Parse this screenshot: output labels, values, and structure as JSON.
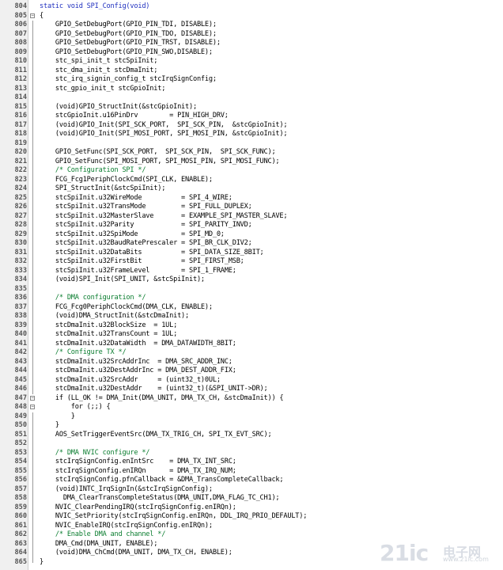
{
  "editor": {
    "lines": [
      {
        "n": "804",
        "t": "static void SPI_Config(void)",
        "k": "keyword"
      },
      {
        "n": "805",
        "t": "{",
        "fold": "minus"
      },
      {
        "n": "806",
        "t": "    GPIO_SetDebugPort(GPIO_PIN_TDI, DISABLE);"
      },
      {
        "n": "807",
        "t": "    GPIO_SetDebugPort(GPIO_PIN_TDO, DISABLE);"
      },
      {
        "n": "808",
        "t": "    GPIO_SetDebugPort(GPIO_PIN_TRST, DISABLE);"
      },
      {
        "n": "809",
        "t": "    GPIO_SetDebugPort(GPIO_PIN_SWO,DISABLE);"
      },
      {
        "n": "810",
        "t": "    stc_spi_init_t stcSpiInit;"
      },
      {
        "n": "811",
        "t": "    stc_dma_init_t stcDmaInit;"
      },
      {
        "n": "812",
        "t": "    stc_irq_signin_config_t stcIrqSignConfig;"
      },
      {
        "n": "813",
        "t": "    stc_gpio_init_t stcGpioInit;"
      },
      {
        "n": "814",
        "t": ""
      },
      {
        "n": "815",
        "t": "    (void)GPIO_StructInit(&stcGpioInit);"
      },
      {
        "n": "816",
        "t": "    stcGpioInit.u16PinDrv        = PIN_HIGH_DRV;"
      },
      {
        "n": "817",
        "t": "    (void)GPIO_Init(SPI_SCK_PORT,  SPI_SCK_PIN,  &stcGpioInit);"
      },
      {
        "n": "818",
        "t": "    (void)GPIO_Init(SPI_MOSI_PORT, SPI_MOSI_PIN, &stcGpioInit);"
      },
      {
        "n": "819",
        "t": ""
      },
      {
        "n": "820",
        "t": "    GPIO_SetFunc(SPI_SCK_PORT,  SPI_SCK_PIN,  SPI_SCK_FUNC);"
      },
      {
        "n": "821",
        "t": "    GPIO_SetFunc(SPI_MOSI_PORT, SPI_MOSI_PIN, SPI_MOSI_FUNC);"
      },
      {
        "n": "822",
        "t": "    /* Configuration SPI */",
        "k": "comment"
      },
      {
        "n": "823",
        "t": "    FCG_Fcg1PeriphClockCmd(SPI_CLK, ENABLE);"
      },
      {
        "n": "824",
        "t": "    SPI_StructInit(&stcSpiInit);"
      },
      {
        "n": "825",
        "t": "    stcSpiInit.u32WireMode          = SPI_4_WIRE;"
      },
      {
        "n": "826",
        "t": "    stcSpiInit.u32TransMode         = SPI_FULL_DUPLEX;"
      },
      {
        "n": "827",
        "t": "    stcSpiInit.u32MasterSlave       = EXAMPLE_SPI_MASTER_SLAVE;"
      },
      {
        "n": "828",
        "t": "    stcSpiInit.u32Parity            = SPI_PARITY_INVD;"
      },
      {
        "n": "829",
        "t": "    stcSpiInit.u32SpiMode           = SPI_MD_0;"
      },
      {
        "n": "830",
        "t": "    stcSpiInit.u32BaudRatePrescaler = SPI_BR_CLK_DIV2;"
      },
      {
        "n": "831",
        "t": "    stcSpiInit.u32DataBits          = SPI_DATA_SIZE_8BIT;"
      },
      {
        "n": "832",
        "t": "    stcSpiInit.u32FirstBit          = SPI_FIRST_MSB;"
      },
      {
        "n": "833",
        "t": "    stcSpiInit.u32FrameLevel        = SPI_1_FRAME;"
      },
      {
        "n": "834",
        "t": "    (void)SPI_Init(SPI_UNIT, &stcSpiInit);"
      },
      {
        "n": "835",
        "t": ""
      },
      {
        "n": "836",
        "t": "    /* DMA configuration */",
        "k": "comment"
      },
      {
        "n": "837",
        "t": "    FCG_Fcg0PeriphClockCmd(DMA_CLK, ENABLE);"
      },
      {
        "n": "838",
        "t": "    (void)DMA_StructInit(&stcDmaInit);"
      },
      {
        "n": "839",
        "t": "    stcDmaInit.u32BlockSize  = 1UL;"
      },
      {
        "n": "840",
        "t": "    stcDmaInit.u32TransCount = 1UL;"
      },
      {
        "n": "841",
        "t": "    stcDmaInit.u32DataWidth  = DMA_DATAWIDTH_8BIT;"
      },
      {
        "n": "842",
        "t": "    /* Configure TX */",
        "k": "comment"
      },
      {
        "n": "843",
        "t": "    stcDmaInit.u32SrcAddrInc  = DMA_SRC_ADDR_INC;"
      },
      {
        "n": "844",
        "t": "    stcDmaInit.u32DestAddrInc = DMA_DEST_ADDR_FIX;"
      },
      {
        "n": "845",
        "t": "    stcDmaInit.u32SrcAddr     = (uint32_t)0UL;"
      },
      {
        "n": "846",
        "t": "    stcDmaInit.u32DestAddr    = (uint32_t)(&SPI_UNIT->DR);"
      },
      {
        "n": "847",
        "t": "    if (LL_OK != DMA_Init(DMA_UNIT, DMA_TX_CH, &stcDmaInit)) {",
        "fold": "minus"
      },
      {
        "n": "848",
        "t": "        for (;;) {",
        "fold": "minus"
      },
      {
        "n": "849",
        "t": "        }",
        "fold": "line"
      },
      {
        "n": "850",
        "t": "    }",
        "fold": "line"
      },
      {
        "n": "851",
        "t": "    AOS_SetTriggerEventSrc(DMA_TX_TRIG_CH, SPI_TX_EVT_SRC);"
      },
      {
        "n": "852",
        "t": ""
      },
      {
        "n": "853",
        "t": "    /* DMA NVIC configure */",
        "k": "comment"
      },
      {
        "n": "854",
        "t": "    stcIrqSignConfig.enIntSrc    = DMA_TX_INT_SRC;"
      },
      {
        "n": "855",
        "t": "    stcIrqSignConfig.enIRQn      = DMA_TX_IRQ_NUM;"
      },
      {
        "n": "856",
        "t": "    stcIrqSignConfig.pfnCallback = &DMA_TransCompleteCallback;"
      },
      {
        "n": "857",
        "t": "    (void)INTC_IrqSignIn(&stcIrqSignConfig);"
      },
      {
        "n": "858",
        "t": "      DMA_ClearTransCompleteStatus(DMA_UNIT,DMA_FLAG_TC_CH1);"
      },
      {
        "n": "859",
        "t": "    NVIC_ClearPendingIRQ(stcIrqSignConfig.enIRQn);"
      },
      {
        "n": "860",
        "t": "    NVIC_SetPriority(stcIrqSignConfig.enIRQn, DDL_IRQ_PRIO_DEFAULT);"
      },
      {
        "n": "861",
        "t": "    NVIC_EnableIRQ(stcIrqSignConfig.enIRQn);"
      },
      {
        "n": "862",
        "t": "    /* Enable DMA and channel */",
        "k": "comment"
      },
      {
        "n": "863",
        "t": "    DMA_Cmd(DMA_UNIT, ENABLE);"
      },
      {
        "n": "864",
        "t": "    (void)DMA_ChCmd(DMA_UNIT, DMA_TX_CH, ENABLE);"
      },
      {
        "n": "865",
        "t": "}",
        "fold": "end"
      }
    ]
  },
  "watermark": {
    "brand": "21ic",
    "cn": "电子网",
    "url": "www.21ic.com"
  },
  "colors": {
    "comment": "#0a7d2f",
    "keyword": "#1f2fbf",
    "gutter_bg": "#f0f0f0",
    "line_number": "#555555"
  }
}
